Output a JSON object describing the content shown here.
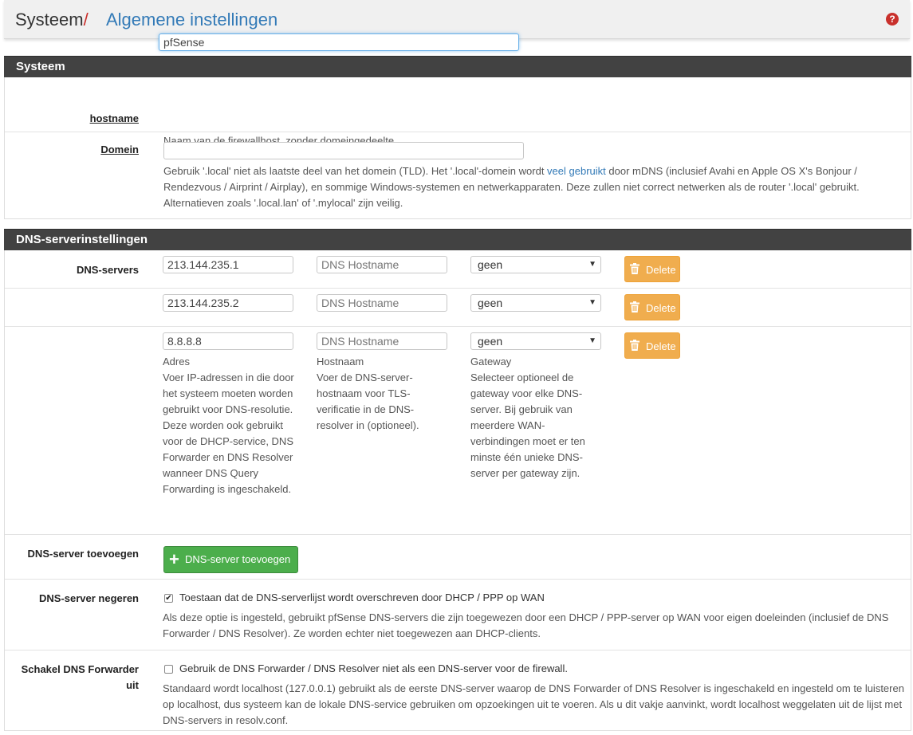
{
  "breadcrumb": {
    "root": "Systeem",
    "separator": "/",
    "page": "Algemene instellingen",
    "help": "?"
  },
  "system": {
    "title": "Systeem",
    "hostname": {
      "label": "hostname",
      "value": "pfSense",
      "help": "Naam van de firewallhost, zonder domeingedeelte"
    },
    "domain": {
      "label": "Domein",
      "value": "",
      "help_before": "Gebruik '.local' niet als laatste deel van het domein (TLD). Het '.local'-domein wordt ",
      "help_link": "veel gebruikt",
      "help_after": " door mDNS (inclusief Avahi en Apple OS X's Bonjour / Rendezvous / Airprint / Airplay), en sommige Windows-systemen en netwerkapparaten. Deze zullen niet correct netwerken als de router '.local' gebruikt. Alternatieven zoals '.local.lan' of '.mylocal' zijn veilig."
    }
  },
  "dns": {
    "title": "DNS-serverinstellingen",
    "servers_label": "DNS-servers",
    "hostname_placeholder": "DNS Hostname",
    "delete_label": "Delete",
    "rows": [
      {
        "address": "213.144.235.1",
        "hostname": "",
        "gateway": "geen"
      },
      {
        "address": "213.144.235.2",
        "hostname": "",
        "gateway": "geen"
      },
      {
        "address": "8.8.8.8",
        "hostname": "",
        "gateway": "geen"
      }
    ],
    "col_help": {
      "address_title": "Adres",
      "address_text": "Voer IP-adressen in die door het systeem moeten worden gebruikt voor DNS-resolutie. Deze worden ook gebruikt voor de DHCP-service, DNS Forwarder en DNS Resolver wanneer DNS Query Forwarding is ingeschakeld.",
      "hostname_title": "Hostnaam",
      "hostname_text": "Voer de DNS-server-hostnaam voor TLS-verificatie in de DNS-resolver in (optioneel).",
      "gateway_title": "Gateway",
      "gateway_text": "Selecteer optioneel de gateway voor elke DNS-server. Bij gebruik van meerdere WAN-verbindingen moet er ten minste één unieke DNS-server per gateway zijn."
    },
    "add": {
      "label": "DNS-server toevoegen",
      "button": "DNS-server toevoegen"
    },
    "override": {
      "label": "DNS-server negeren",
      "checked": true,
      "checkbox_label": "Toestaan dat de DNS-serverlijst wordt overschreven door DHCP / PPP op WAN",
      "help": "Als deze optie is ingesteld, gebruikt pfSense DNS-servers die zijn toegewezen door een DHCP / PPP-server op WAN voor eigen doeleinden (inclusief de DNS Forwarder / DNS Resolver). Ze worden echter niet toegewezen aan DHCP-clients."
    },
    "disable_forwarder": {
      "label_line1": "Schakel DNS Forwarder",
      "label_line2": "uit",
      "checked": false,
      "checkbox_label": "Gebruik de DNS Forwarder / DNS Resolver niet als een DNS-server voor de firewall.",
      "help": "Standaard wordt localhost (127.0.0.1) gebruikt als de eerste DNS-server waarop de DNS Forwarder of DNS Resolver is ingeschakeld en ingesteld om te luisteren op localhost, dus systeem kan de lokale DNS-service gebruiken om opzoekingen uit te voeren. Als u dit vakje aanvinkt, wordt localhost weggelaten uit de lijst met DNS-servers in resolv.conf."
    }
  }
}
